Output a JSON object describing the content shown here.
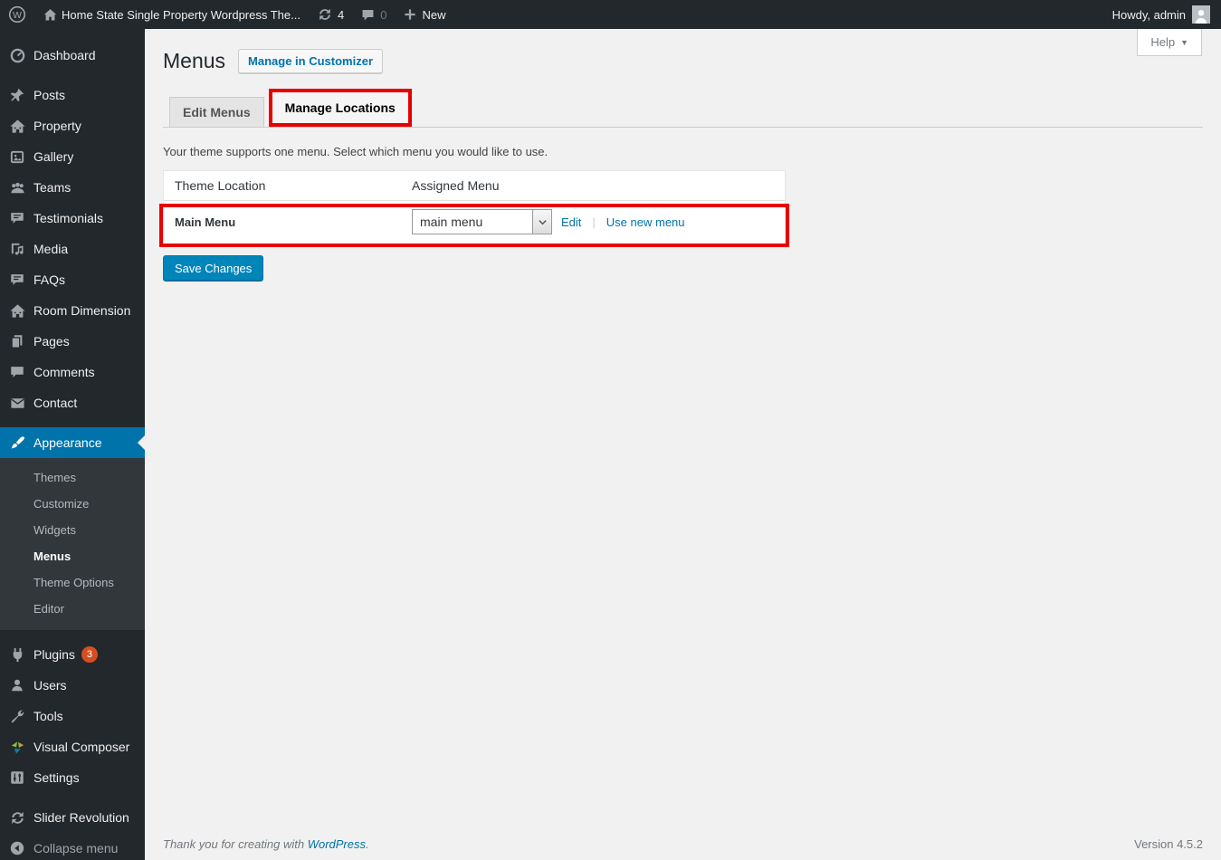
{
  "admin_bar": {
    "site_title": "Home State Single Property Wordpress The...",
    "updates_count": "4",
    "comments_count": "0",
    "new_label": "New",
    "howdy": "Howdy, admin"
  },
  "help": {
    "label": "Help"
  },
  "sidebar": {
    "items": [
      {
        "label": "Dashboard"
      },
      {
        "label": "Posts"
      },
      {
        "label": "Property"
      },
      {
        "label": "Gallery"
      },
      {
        "label": "Teams"
      },
      {
        "label": "Testimonials"
      },
      {
        "label": "Media"
      },
      {
        "label": "FAQs"
      },
      {
        "label": "Room Dimension"
      },
      {
        "label": "Pages"
      },
      {
        "label": "Comments"
      },
      {
        "label": "Contact"
      },
      {
        "label": "Appearance"
      },
      {
        "label": "Plugins"
      },
      {
        "label": "Users"
      },
      {
        "label": "Tools"
      },
      {
        "label": "Visual Composer"
      },
      {
        "label": "Settings"
      },
      {
        "label": "Slider Revolution"
      },
      {
        "label": "Collapse menu"
      }
    ],
    "plugins_badge": "3",
    "submenu": [
      "Themes",
      "Customize",
      "Widgets",
      "Menus",
      "Theme Options",
      "Editor"
    ]
  },
  "main": {
    "page_title": "Menus",
    "manage_in_customizer": "Manage in Customizer",
    "tabs": [
      {
        "label": "Edit Menus"
      },
      {
        "label": "Manage Locations"
      }
    ],
    "description": "Your theme supports one menu. Select which menu you would like to use.",
    "table": {
      "headers": [
        "Theme Location",
        "Assigned Menu"
      ],
      "rows": [
        {
          "location": "Main Menu",
          "selected_menu": "main menu",
          "edit_label": "Edit",
          "use_new_label": "Use new menu"
        }
      ]
    },
    "save_button": "Save Changes"
  },
  "footer": {
    "thanks_prefix": "Thank you for creating with ",
    "wordpress_link": "WordPress",
    "thanks_suffix": ".",
    "version": "Version 4.5.2"
  },
  "colors": {
    "admin_bar_bg": "#23282d",
    "sidebar_bg": "#23282d",
    "submenu_bg": "#32373c",
    "active_item_bg": "#0073aa",
    "link": "#0073aa",
    "primary_button_bg": "#0085ba",
    "highlight_red": "#e80000",
    "badge": "#d54e21",
    "content_bg": "#f1f1f1"
  }
}
